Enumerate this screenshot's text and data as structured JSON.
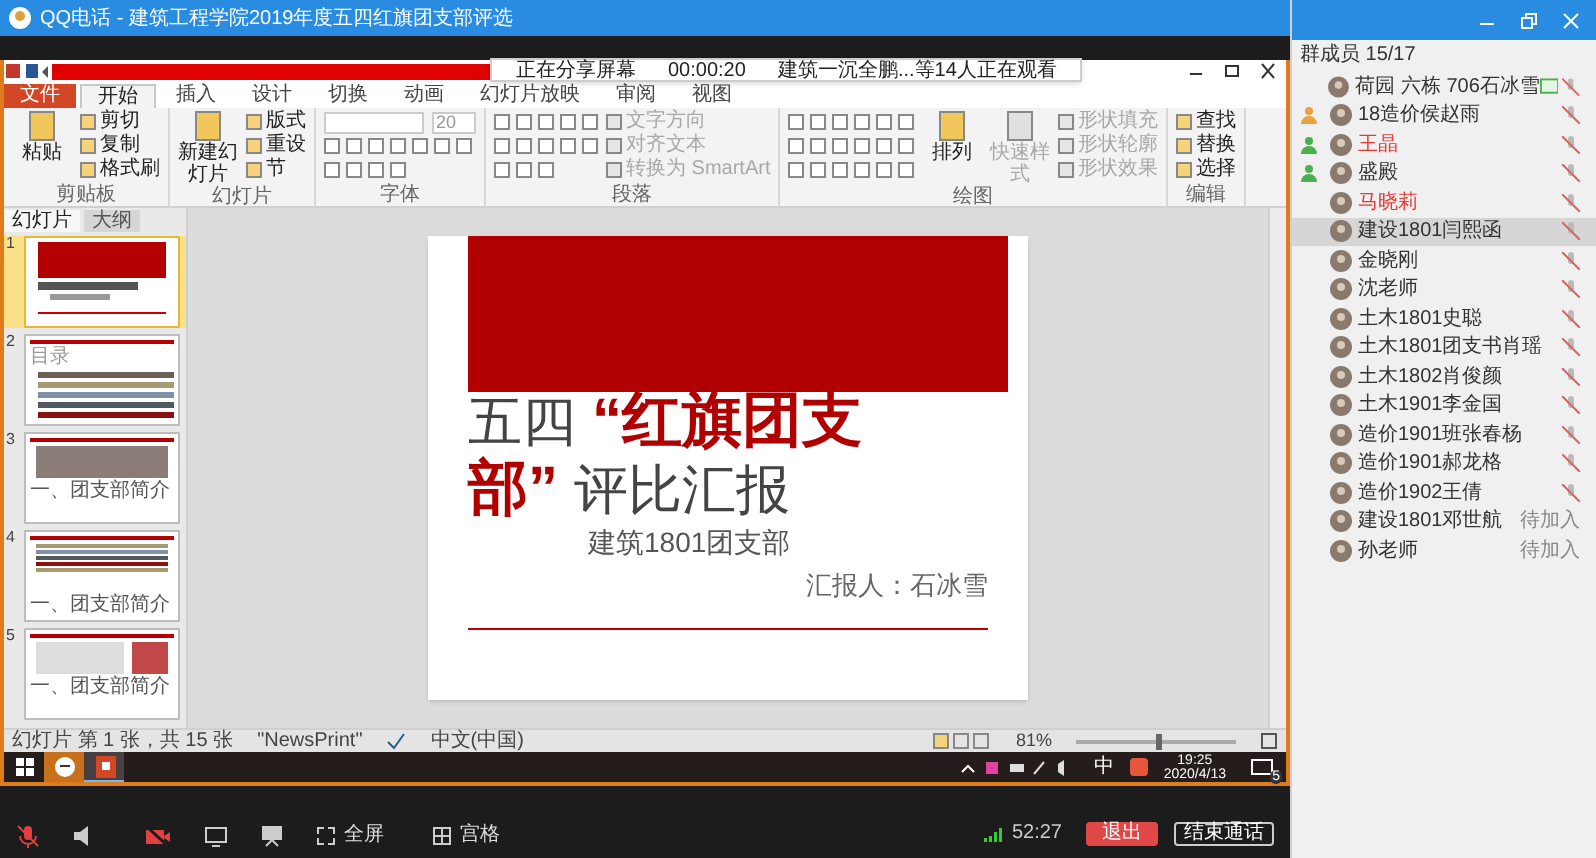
{
  "window": {
    "title": "QQ电话 - 建筑工程学院2019年度五四红旗团支部评选"
  },
  "share_banner": {
    "status": "正在分享屏幕",
    "timer": "00:00:20",
    "viewers": "建筑一沉全鹏...等14人正在观看"
  },
  "ribbon": {
    "tabs": [
      {
        "label": "文件",
        "kind": "file",
        "selected": false
      },
      {
        "label": "开始",
        "kind": "tab",
        "selected": true
      },
      {
        "label": "插入",
        "kind": "tab",
        "selected": false
      },
      {
        "label": "设计",
        "kind": "tab",
        "selected": false
      },
      {
        "label": "切换",
        "kind": "tab",
        "selected": false
      },
      {
        "label": "动画",
        "kind": "tab",
        "selected": false
      },
      {
        "label": "幻灯片放映",
        "kind": "tab",
        "selected": false
      },
      {
        "label": "审阅",
        "kind": "tab",
        "selected": false
      },
      {
        "label": "视图",
        "kind": "tab",
        "selected": false
      }
    ],
    "groups": [
      {
        "kind": "buttons",
        "label": "剪贴板",
        "large": [
          {
            "label": "粘贴",
            "disabled": false
          }
        ],
        "small": [
          {
            "label": "剪切",
            "disabled": false
          },
          {
            "label": "复制",
            "disabled": false
          },
          {
            "label": "格式刷",
            "disabled": false
          }
        ]
      },
      {
        "kind": "buttons",
        "label": "幻灯片",
        "large": [
          {
            "label": "新建幻灯片",
            "disabled": false
          }
        ],
        "small": [
          {
            "label": "版式",
            "disabled": false
          },
          {
            "label": "重设",
            "disabled": false
          },
          {
            "label": "节",
            "disabled": false
          }
        ]
      },
      {
        "kind": "font",
        "label": "字体",
        "size": "20"
      },
      {
        "kind": "paragraph",
        "label": "段落",
        "small": [
          {
            "label": "文字方向",
            "disabled": true
          },
          {
            "label": "对齐文本",
            "disabled": true
          },
          {
            "label": "转换为 SmartArt",
            "disabled": true
          }
        ]
      },
      {
        "kind": "drawing",
        "label": "绘图",
        "large": [
          {
            "label": "排列",
            "disabled": false
          },
          {
            "label": "快速样式",
            "disabled": true
          }
        ],
        "small": [
          {
            "label": "形状填充",
            "disabled": true
          },
          {
            "label": "形状轮廓",
            "disabled": true
          },
          {
            "label": "形状效果",
            "disabled": true
          }
        ]
      },
      {
        "kind": "buttons",
        "label": "编辑",
        "small": [
          {
            "label": "查找",
            "disabled": false
          },
          {
            "label": "替换",
            "disabled": false
          },
          {
            "label": "选择",
            "disabled": false
          }
        ]
      }
    ]
  },
  "slides_panel": {
    "tabs": [
      {
        "label": "幻灯片",
        "selected": true
      },
      {
        "label": "大纲",
        "selected": false
      }
    ],
    "thumbnails": [
      {
        "number": "1",
        "kind": "cover",
        "selected": true
      },
      {
        "number": "2",
        "kind": "agenda",
        "title": "目录",
        "selected": false
      },
      {
        "number": "3",
        "kind": "table",
        "title": "一、团支部简介",
        "selected": false
      },
      {
        "number": "4",
        "kind": "list",
        "title": "一、团支部简介",
        "selected": false
      },
      {
        "number": "5",
        "kind": "images",
        "title": "一、团支部简介",
        "selected": false
      }
    ]
  },
  "slide": {
    "title_lines": [
      [
        {
          "text": "五四",
          "emphasis": false
        },
        {
          "text": "“红旗团支",
          "emphasis": true
        }
      ],
      [
        {
          "text": "部”",
          "emphasis": true
        },
        {
          "text": "评比汇报",
          "emphasis": false
        }
      ]
    ],
    "subtitle": "建筑1801团支部",
    "reporter": "汇报人：石冰雪"
  },
  "status_bar": {
    "slide_info": "幻灯片 第 1 张，共 15 张",
    "theme": "\"NewsPrint\"",
    "language": "中文(中国)",
    "zoom": "81%",
    "zoom_slider": {
      "level": 0.5
    }
  },
  "taskbar": {
    "apps": [
      {
        "kind": "start",
        "selected": false
      },
      {
        "kind": "qq",
        "selected": false
      },
      {
        "kind": "powerpoint",
        "selected": true
      }
    ],
    "ime": "中",
    "time": "19:25",
    "date": "2020/4/13",
    "notifications": "5"
  },
  "call_bar": {
    "mic_muted": true,
    "camera_off": true,
    "fullscreen": "全屏",
    "grid": "宫格",
    "duration": "52:27",
    "quit": "退出",
    "end": "结束通话"
  },
  "members": {
    "title": "群成员 15/17",
    "items": [
      {
        "name": "荷园 六栋 706石冰雪",
        "highlighted": false,
        "kind": "sharing",
        "selected": false
      },
      {
        "name": "18造价侯赵雨",
        "highlighted": false,
        "badge": {
          "color": "#e8a33c"
        },
        "kind": "muted",
        "selected": false
      },
      {
        "name": "王晶",
        "highlighted": true,
        "badge": {
          "color": "#4caf50"
        },
        "kind": "muted",
        "selected": false
      },
      {
        "name": "盛殿",
        "highlighted": false,
        "badge": {
          "color": "#4caf50"
        },
        "kind": "muted",
        "selected": false
      },
      {
        "name": "马晓莉",
        "highlighted": true,
        "kind": "muted",
        "selected": false
      },
      {
        "name": "建设1801闫熙函",
        "highlighted": false,
        "kind": "muted",
        "selected": true
      },
      {
        "name": "金晓刚",
        "highlighted": false,
        "kind": "muted",
        "selected": false
      },
      {
        "name": "沈老师",
        "highlighted": false,
        "kind": "muted",
        "selected": false
      },
      {
        "name": "土木1801史聪",
        "highlighted": false,
        "kind": "muted",
        "selected": false
      },
      {
        "name": "土木1801团支书肖瑶",
        "highlighted": false,
        "kind": "muted",
        "selected": false
      },
      {
        "name": "土木1802肖俊颜",
        "highlighted": false,
        "kind": "muted",
        "selected": false
      },
      {
        "name": "土木1901李金国",
        "highlighted": false,
        "kind": "muted",
        "selected": false
      },
      {
        "name": "造价1901班张春杨",
        "highlighted": false,
        "kind": "muted",
        "selected": false
      },
      {
        "name": "造价1901郝龙格",
        "highlighted": false,
        "kind": "muted",
        "selected": false
      },
      {
        "name": "造价1902王倩",
        "highlighted": false,
        "kind": "muted",
        "selected": false
      },
      {
        "name": "建设1801邓世航",
        "highlighted": false,
        "kind": "pending",
        "status_text": "待加入",
        "selected": false
      },
      {
        "name": "孙老师",
        "highlighted": false,
        "kind": "pending",
        "status_text": "待加入",
        "selected": false
      }
    ]
  }
}
